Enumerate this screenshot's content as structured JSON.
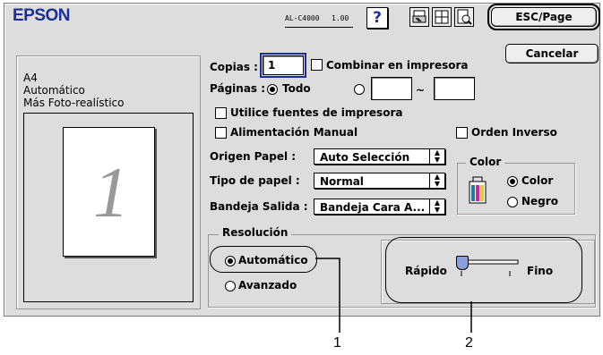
{
  "header": {
    "brand": "EPSON",
    "model": "AL-C4000",
    "version": "1.00",
    "help_label": "?",
    "esc_page_label": "ESC/Page",
    "cancel_label": "Cancelar"
  },
  "summary": {
    "line1": "A4",
    "line2": "Automático",
    "line3": "Más Foto-realístico",
    "preview_digit": "1"
  },
  "copies": {
    "label": "Copias :",
    "value": "1",
    "collate_label": "Combinar en impresora",
    "collate_checked": false
  },
  "pages": {
    "label": "Páginas :",
    "all_label": "Todo",
    "all_selected": true,
    "range_from": "",
    "range_sep": "~",
    "range_to": ""
  },
  "options": {
    "printer_fonts_label": "Utilice fuentes de impresora",
    "printer_fonts_checked": false,
    "manual_feed_label": "Alimentación Manual",
    "manual_feed_checked": false,
    "reverse_order_label": "Orden Inverso",
    "reverse_order_checked": false
  },
  "paper": {
    "source_label": "Origen Papel :",
    "source_value": "Auto Selección",
    "type_label": "Tipo de papel :",
    "type_value": "Normal",
    "output_label": "Bandeja Salida :",
    "output_value": "Bandeja Cara A..."
  },
  "color": {
    "group_label": "Color",
    "color_label": "Color",
    "color_selected": true,
    "mono_label": "Negro"
  },
  "resolution": {
    "group_label": "Resolución",
    "auto_label": "Automático",
    "auto_selected": true,
    "advanced_label": "Avanzado",
    "fast_label": "Rápido",
    "fine_label": "Fino",
    "slider_level": 0
  },
  "callouts": {
    "one": "1",
    "two": "2"
  }
}
